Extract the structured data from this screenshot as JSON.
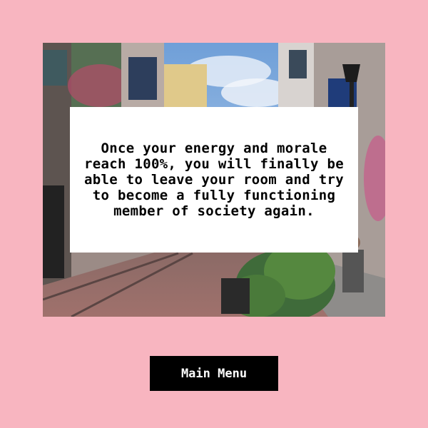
{
  "dialog": {
    "message": "Once your energy and morale reach 100%, you will finally be able to leave your room and try to become a fully functioning member of society again."
  },
  "menu_button": {
    "label": "Main Menu"
  },
  "colors": {
    "background": "#f8b5c0",
    "dialog_background": "#ffffff",
    "button_background": "#000000",
    "button_text": "#ffffff"
  }
}
